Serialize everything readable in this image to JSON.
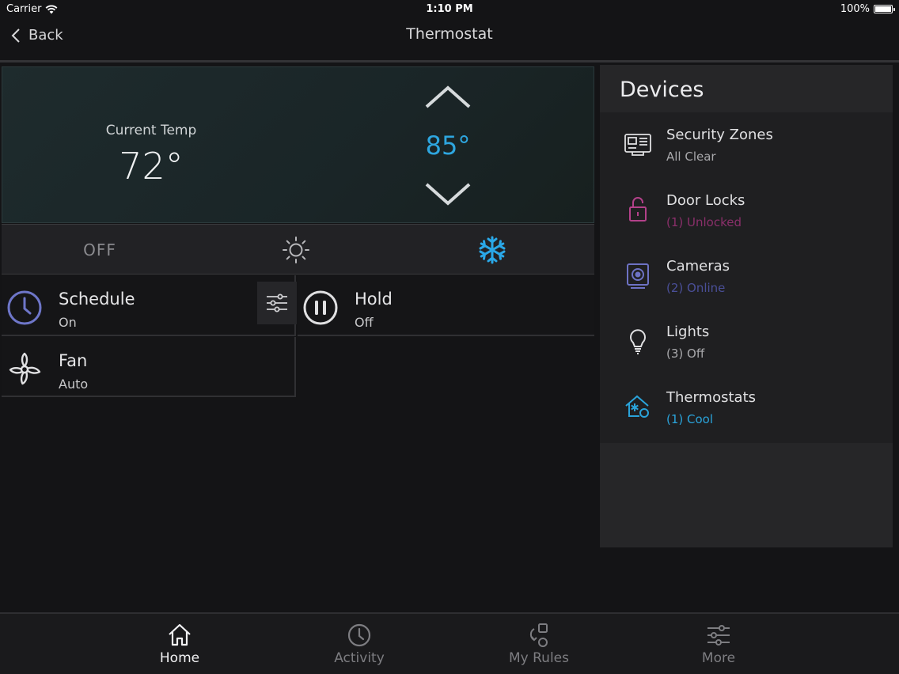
{
  "status_bar": {
    "carrier": "Carrier",
    "time": "1:10 PM",
    "battery": "100%"
  },
  "nav": {
    "back_label": "Back",
    "title": "Thermostat"
  },
  "thermostat": {
    "current_label": "Current Temp",
    "current_value": "72°",
    "setpoint": "85°",
    "setpoint_color": "#2ea6df"
  },
  "modes": {
    "off_label": "OFF",
    "heat_icon": "sun-icon",
    "cool_icon": "snowflake-icon",
    "selected": "cool",
    "cool_color": "#2aa8e8"
  },
  "tiles": {
    "schedule": {
      "title": "Schedule",
      "status": "On",
      "icon": "clock-icon",
      "icon_color": "#6e76c9"
    },
    "hold": {
      "title": "Hold",
      "status": "Off",
      "icon": "pause-icon"
    },
    "fan": {
      "title": "Fan",
      "status": "Auto",
      "icon": "fan-icon"
    }
  },
  "devices": {
    "title": "Devices",
    "items": [
      {
        "name": "Security Zones",
        "status": "All Clear",
        "icon": "security-panel-icon",
        "status_color": "#a8a8ab"
      },
      {
        "name": "Door Locks",
        "status": "(1) Unlocked",
        "icon": "unlocked-padlock-icon",
        "status_color": "#8a2f6a",
        "icon_color": "#b3418a"
      },
      {
        "name": "Cameras",
        "status": "(2) Online",
        "icon": "camera-icon",
        "status_color": "#4a4f98",
        "icon_color": "#6d72c4"
      },
      {
        "name": "Lights",
        "status": "(3) Off",
        "icon": "lightbulb-icon",
        "status_color": "#a8a8ab"
      },
      {
        "name": "Thermostats",
        "status": "(1) Cool",
        "icon": "thermostat-house-icon",
        "status_color": "#2aa3da",
        "icon_color": "#2aa3da"
      }
    ]
  },
  "tabbar": {
    "items": [
      {
        "label": "Home",
        "icon": "home-icon",
        "active": true
      },
      {
        "label": "Activity",
        "icon": "clock-icon",
        "active": false
      },
      {
        "label": "My Rules",
        "icon": "rules-icon",
        "active": false
      },
      {
        "label": "More",
        "icon": "sliders-icon",
        "active": false
      }
    ],
    "active_color": "#f2f2f4",
    "inactive_color": "#7d7d81"
  }
}
